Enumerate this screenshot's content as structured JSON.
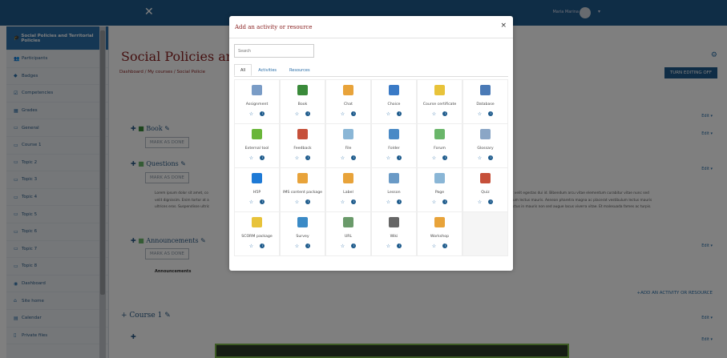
{
  "navbar": {
    "close_glyph": "✕",
    "username": "Maria Marina",
    "icons": "▲ ●"
  },
  "sidebar": {
    "items": [
      {
        "label": "Social Policies and Territorial Policies",
        "icon": "graduation-cap-icon",
        "active": true
      },
      {
        "label": "Participants",
        "icon": "users-icon"
      },
      {
        "label": "Badges",
        "icon": "badge-icon"
      },
      {
        "label": "Competencies",
        "icon": "check-icon"
      },
      {
        "label": "Grades",
        "icon": "table-icon"
      },
      {
        "label": "General",
        "icon": "folder-icon"
      },
      {
        "label": "Course 1",
        "icon": "folder-icon"
      },
      {
        "label": "Topic 2",
        "icon": "folder-icon"
      },
      {
        "label": "Topic 3",
        "icon": "folder-icon"
      },
      {
        "label": "Topic 4",
        "icon": "folder-icon"
      },
      {
        "label": "Topic 5",
        "icon": "folder-icon"
      },
      {
        "label": "Topic 6",
        "icon": "folder-icon"
      },
      {
        "label": "Topic 7",
        "icon": "folder-icon"
      },
      {
        "label": "Topic 8",
        "icon": "folder-icon"
      },
      {
        "label": "Dashboard",
        "icon": "dashboard-icon"
      },
      {
        "label": "Site home",
        "icon": "home-icon"
      },
      {
        "label": "Calendar",
        "icon": "calendar-icon"
      },
      {
        "label": "Private files",
        "icon": "file-icon"
      }
    ]
  },
  "main": {
    "title": "Social Policies ar",
    "breadcrumb": "Dashboard / My courses / Social Policie",
    "turn_editing": "TURN EDITING OFF",
    "edit_label": "Edit ▾",
    "add_activity": "+ADD AN ACTIVITY OR RESOURCE",
    "course1": "+ Course 1 ✎",
    "sections": [
      {
        "name": "Book",
        "markdone": "MARK AS DONE"
      },
      {
        "name": "Questions",
        "markdone": "MARK AS DONE"
      },
      {
        "name": "Announcements",
        "markdone": "MARK AS DONE",
        "sub": "Announcements"
      }
    ],
    "lorem_left": "Lorem ipsum dolor sit amet, co",
    "lorem_left2": "velit dignissim. Enim tortor at a",
    "lorem_left3": "ultrices eros. Suspendisse ultric",
    "lorem_right": "ut velit egestas dui id. Bibendum arcu vitae elementum curabitur vitae nunc sed",
    "lorem_right2": "ctum lectus mauris. Aenean pharetra magna ac placerat vestibulum lectus mauris",
    "lorem_right3": "lectus in mauris non sed augue lacus viverra vitae. Et malesuada fames ac turpis."
  },
  "modal": {
    "title": "Add an activity or resource",
    "close": "×",
    "search_placeholder": "Search",
    "tabs": [
      "All",
      "Activities",
      "Resources"
    ],
    "tiles": [
      {
        "name": "Assignment",
        "icon": "assignment-icon",
        "color": "#7a9cc6"
      },
      {
        "name": "Book",
        "icon": "book-icon",
        "color": "#3a8a3a"
      },
      {
        "name": "Chat",
        "icon": "chat-icon",
        "color": "#e8a33a"
      },
      {
        "name": "Choice",
        "icon": "question-icon",
        "color": "#3a7ac6"
      },
      {
        "name": "Course certificate",
        "icon": "certificate-icon",
        "color": "#e8c33a"
      },
      {
        "name": "Database",
        "icon": "database-icon",
        "color": "#4a7ab6"
      },
      {
        "name": "External tool",
        "icon": "puzzle-icon",
        "color": "#6ab63a"
      },
      {
        "name": "Feedback",
        "icon": "feedback-icon",
        "color": "#c6503a"
      },
      {
        "name": "File",
        "icon": "file-icon",
        "color": "#8ab6d6"
      },
      {
        "name": "Folder",
        "icon": "folder-icon",
        "color": "#4a8ac6"
      },
      {
        "name": "Forum",
        "icon": "forum-icon",
        "color": "#6ab66a"
      },
      {
        "name": "Glossary",
        "icon": "glossary-icon",
        "color": "#8aa6c6"
      },
      {
        "name": "H5P",
        "icon": "h5p-icon",
        "color": "#1e7ad6"
      },
      {
        "name": "IMS content package",
        "icon": "package-icon",
        "color": "#e8a33a"
      },
      {
        "name": "Label",
        "icon": "label-icon",
        "color": "#e8a33a"
      },
      {
        "name": "Lesson",
        "icon": "lesson-icon",
        "color": "#6a9ac6"
      },
      {
        "name": "Page",
        "icon": "page-icon",
        "color": "#8ab6d6"
      },
      {
        "name": "Quiz",
        "icon": "quiz-icon",
        "color": "#c6503a"
      },
      {
        "name": "SCORM package",
        "icon": "scorm-icon",
        "color": "#e8c33a"
      },
      {
        "name": "Survey",
        "icon": "survey-icon",
        "color": "#3a8ac6"
      },
      {
        "name": "URL",
        "icon": "url-icon",
        "color": "#6a9a6a"
      },
      {
        "name": "Wiki",
        "icon": "wiki-icon",
        "color": "#666666"
      },
      {
        "name": "Workshop",
        "icon": "workshop-icon",
        "color": "#e8a33a"
      }
    ]
  }
}
